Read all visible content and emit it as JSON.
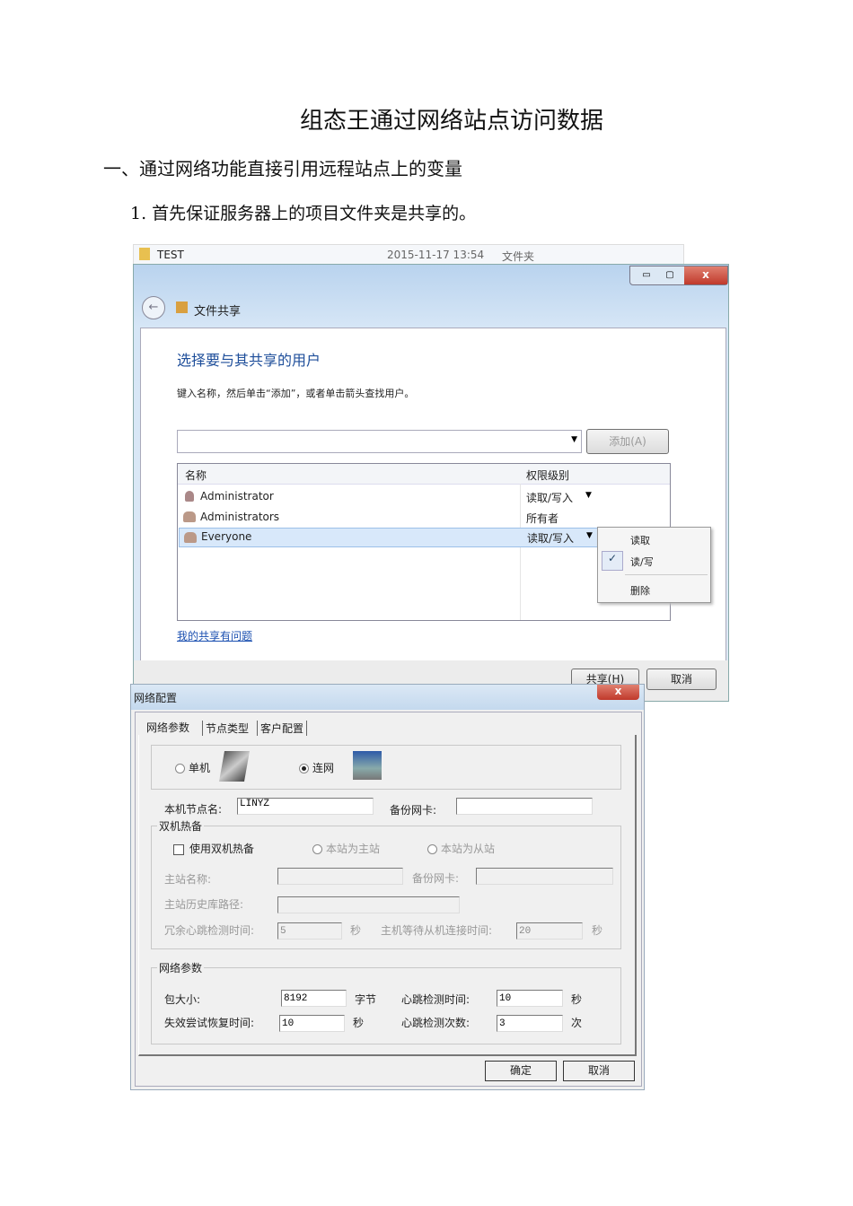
{
  "doc": {
    "title": "组态王通过网络站点访问数据",
    "heading1": "一、通过网络功能直接引用远程站点上的变量",
    "step1": "1. 首先保证服务器上的项目文件夹是共享的。"
  },
  "share": {
    "file_row": {
      "name": "TEST",
      "date": "2015-11-17 13:54",
      "type": "文件夹"
    },
    "nav_title": "文件共享",
    "heading": "选择要与其共享的用户",
    "instruction": "键入名称，然后单击“添加”，或者单击箭头查找用户。",
    "add_button": "添加(A)",
    "columns": {
      "name": "名称",
      "level": "权限级别"
    },
    "rows": [
      {
        "name": "Administrator",
        "level": "读取/写入"
      },
      {
        "name": "Administrators",
        "level": "所有者"
      },
      {
        "name": "Everyone",
        "level": "读取/写入"
      }
    ],
    "menu": [
      {
        "label": "读取",
        "checked": false
      },
      {
        "label": "读/写",
        "checked": true
      },
      {
        "label": "删除",
        "checked": false
      }
    ],
    "help_link": "我的共享有问题",
    "share_button": "共享(H)",
    "cancel_button": "取消",
    "close_glyph": "x"
  },
  "netcfg": {
    "title": "网络配置",
    "close_glyph": "x",
    "tabs": [
      "网络参数",
      "节点类型",
      "客户配置"
    ],
    "mode_standalone": "单机",
    "mode_network": "连网",
    "node_name_label": "本机节点名:",
    "node_name": "LINYZ",
    "backup_nic_label": "备份网卡:",
    "hot_standby": {
      "group": "双机热备",
      "use": "使用双机热备",
      "master": "本站为主站",
      "slave": "本站为从站",
      "master_name": "主站名称:",
      "backup_nic": "备份网卡:",
      "history_path": "主站历史库路径:",
      "heartbeat_label": "冗余心跳检测时间:",
      "heartbeat": "5",
      "sec1": "秒",
      "wait_label": "主机等待从机连接时间:",
      "wait": "20",
      "sec2": "秒"
    },
    "net_params": {
      "group": "网络参数",
      "packet_label": "包大小:",
      "packet": "8192",
      "bytes": "字节",
      "hb_time_label": "心跳检测时间:",
      "hb_time": "10",
      "sec_a": "秒",
      "retry_label": "失效尝试恢复时间:",
      "retry": "10",
      "sec_b": "秒",
      "hb_count_label": "心跳检测次数:",
      "hb_count": "3",
      "times": "次"
    },
    "ok_button": "确定",
    "cancel_button": "取消"
  }
}
